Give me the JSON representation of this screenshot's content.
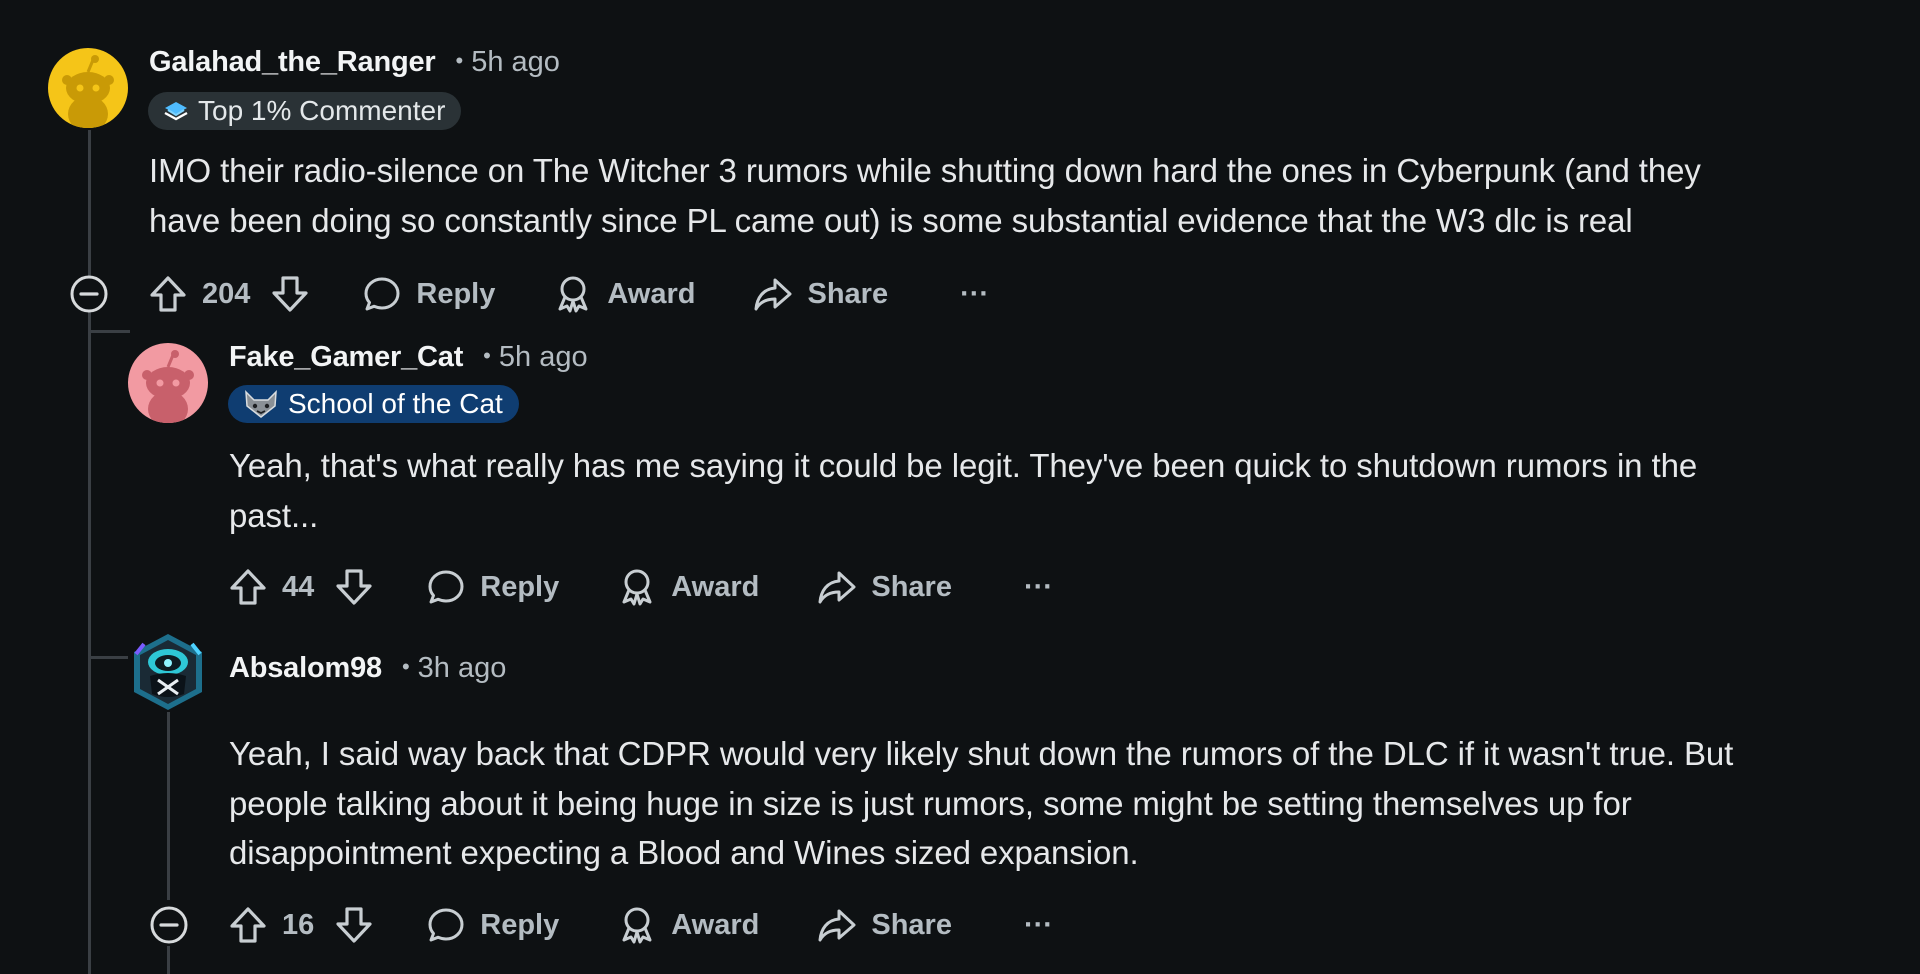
{
  "comments": [
    {
      "username": "Galahad_the_Ranger",
      "time": "5h ago",
      "flair": "Top 1% Commenter",
      "body_lines": [
        "IMO their radio-silence on The Witcher 3 rumors while shutting down hard the ones in Cyberpunk (and they",
        "have been doing so constantly since PL came out) is some substantial evidence that the W3 dlc is real"
      ],
      "votes": "204",
      "reply": "Reply",
      "award": "Award",
      "share": "Share",
      "more": "···"
    },
    {
      "username": "Fake_Gamer_Cat",
      "time": "5h ago",
      "flair": "School of the Cat",
      "body_lines": [
        "Yeah, that's what really has me saying it could be legit. They've been quick to shutdown rumors in the",
        "past..."
      ],
      "votes": "44",
      "reply": "Reply",
      "award": "Award",
      "share": "Share",
      "more": "···"
    },
    {
      "username": "Absalom98",
      "time": "3h ago",
      "body_lines": [
        "Yeah, I said way back that CDPR would very likely shut down the rumors of the DLC if it wasn't true. But",
        "people talking about it being huge in size is just rumors, some might be setting themselves up for",
        "disappointment expecting a Blood and Wines sized expansion."
      ],
      "votes": "16",
      "reply": "Reply",
      "award": "Award",
      "share": "Share",
      "more": "···"
    }
  ],
  "separator": "•",
  "colors": {
    "background": "#0e1113",
    "avatar_1": "#f5c518",
    "avatar_2": "#f29aa2",
    "flair_gray": "#2a3236",
    "flair_blue": "#0f3d71",
    "meta_text": "#b4bcc2"
  },
  "icons": [
    "snoo-avatar-icon",
    "upvote-icon",
    "downvote-icon",
    "reply-icon",
    "award-icon",
    "share-icon",
    "more-icon",
    "collapse-icon",
    "commenter-badge-icon",
    "cat-school-icon"
  ]
}
